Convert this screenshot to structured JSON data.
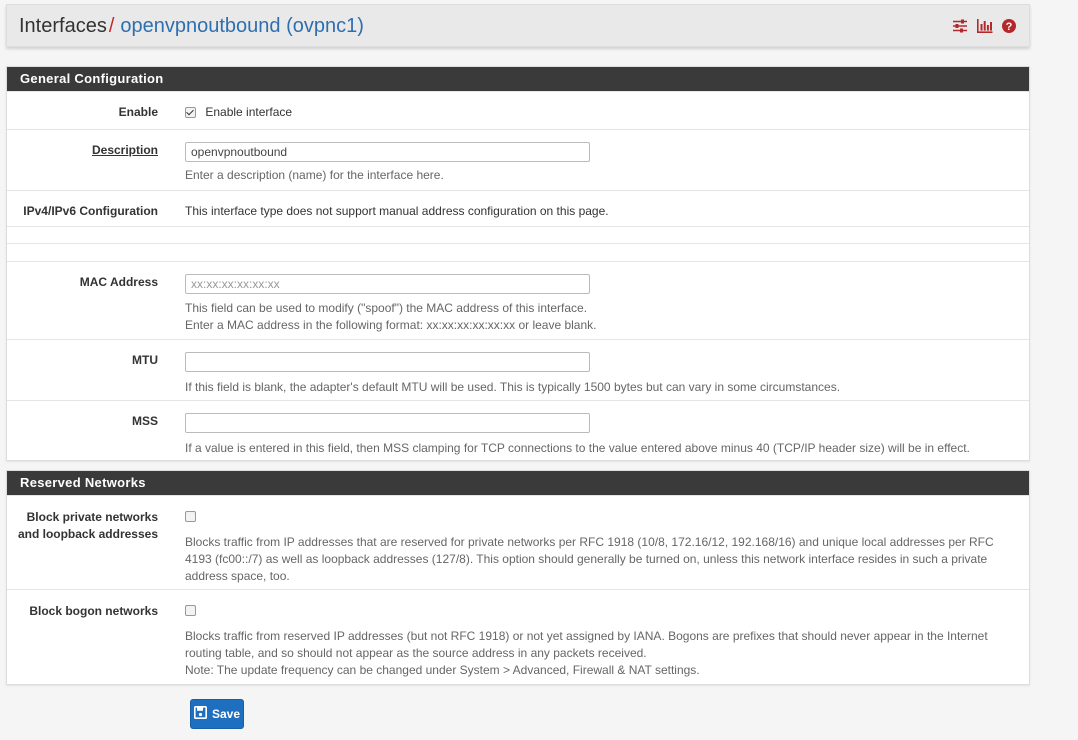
{
  "breadcrumb": {
    "root": "Interfaces",
    "separator": "/",
    "current": "openvpnoutbound (ovpnc1)",
    "icons": [
      "sliders-icon",
      "bar-chart-icon",
      "help-icon"
    ]
  },
  "colors": {
    "accent_red": "#c12a2a",
    "link_blue": "#2f6fb0",
    "panel_heading": "#3a3a3a",
    "save_button": "#1e6fbf"
  },
  "general": {
    "heading": "General Configuration",
    "enable": {
      "label": "Enable",
      "checkbox_text": "Enable interface",
      "checked": true
    },
    "description": {
      "label": "Description",
      "value": "openvpnoutbound",
      "help": "Enter a description (name) for the interface here."
    },
    "ipconfig": {
      "label": "IPv4/IPv6 Configuration",
      "text": "This interface type does not support manual address configuration on this page."
    },
    "mac": {
      "label": "MAC Address",
      "placeholder": "xx:xx:xx:xx:xx:xx",
      "help1": "This field can be used to modify (\"spoof\") the MAC address of this interface.",
      "help2": "Enter a MAC address in the following format: xx:xx:xx:xx:xx:xx or leave blank."
    },
    "mtu": {
      "label": "MTU",
      "value": "",
      "help": "If this field is blank, the adapter's default MTU will be used. This is typically 1500 bytes but can vary in some circumstances."
    },
    "mss": {
      "label": "MSS",
      "value": "",
      "help": "If a value is entered in this field, then MSS clamping for TCP connections to the value entered above minus 40 (TCP/IP header size) will be in effect."
    }
  },
  "reserved": {
    "heading": "Reserved Networks",
    "private": {
      "label_line1": "Block private networks",
      "label_line2": "and loopback addresses",
      "checked": false,
      "help": "Blocks traffic from IP addresses that are reserved for private networks per RFC 1918 (10/8, 172.16/12, 192.168/16) and unique local addresses per RFC 4193 (fc00::/7) as well as loopback addresses (127/8). This option should generally be turned on, unless this network interface resides in such a private address space, too."
    },
    "bogon": {
      "label": "Block bogon networks",
      "checked": false,
      "help1": "Blocks traffic from reserved IP addresses (but not RFC 1918) or not yet assigned by IANA. Bogons are prefixes that should never appear in the Internet routing table, and so should not appear as the source address in any packets received.",
      "help2": "Note: The update frequency can be changed under System > Advanced, Firewall & NAT settings."
    }
  },
  "save_label": "Save"
}
